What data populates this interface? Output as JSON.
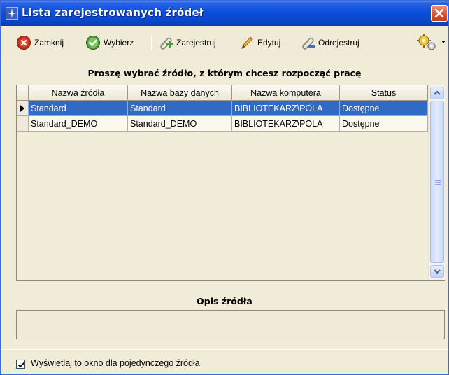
{
  "window": {
    "title": "Lista zarejestrowanych źródeł"
  },
  "toolbar": {
    "close_label": "Zamknij",
    "select_label": "Wybierz",
    "register_label": "Zarejestruj",
    "edit_label": "Edytuj",
    "unregister_label": "Odrejestruj",
    "icons": [
      "close-circle-icon",
      "check-circle-icon",
      "register-clip-icon",
      "pencil-icon",
      "paperclip-icon",
      "config-gears-icon"
    ]
  },
  "main": {
    "choose_label": "Proszę wybrać źródło, z którym chcesz rozpocząć pracę"
  },
  "grid": {
    "columns": [
      "Nazwa źródła",
      "Nazwa bazy danych",
      "Nazwa komputera",
      "Status"
    ],
    "rows": [
      [
        "Standard",
        "Standard",
        "BIBLIOTEKARZ\\POLA",
        "Dostępne"
      ],
      [
        "Standard_DEMO",
        "Standard_DEMO",
        "BIBLIOTEKARZ\\POLA",
        "Dostępne"
      ]
    ],
    "selected_row": 0
  },
  "description": {
    "label": "Opis źródła",
    "text": ""
  },
  "footer": {
    "checkbox_label": "Wyświetlaj to okno dla pojedynczego źródła",
    "checked": true
  },
  "colors": {
    "titlebar": "#0b4fdc",
    "selection": "#316ac5",
    "background": "#f1ecd8"
  }
}
